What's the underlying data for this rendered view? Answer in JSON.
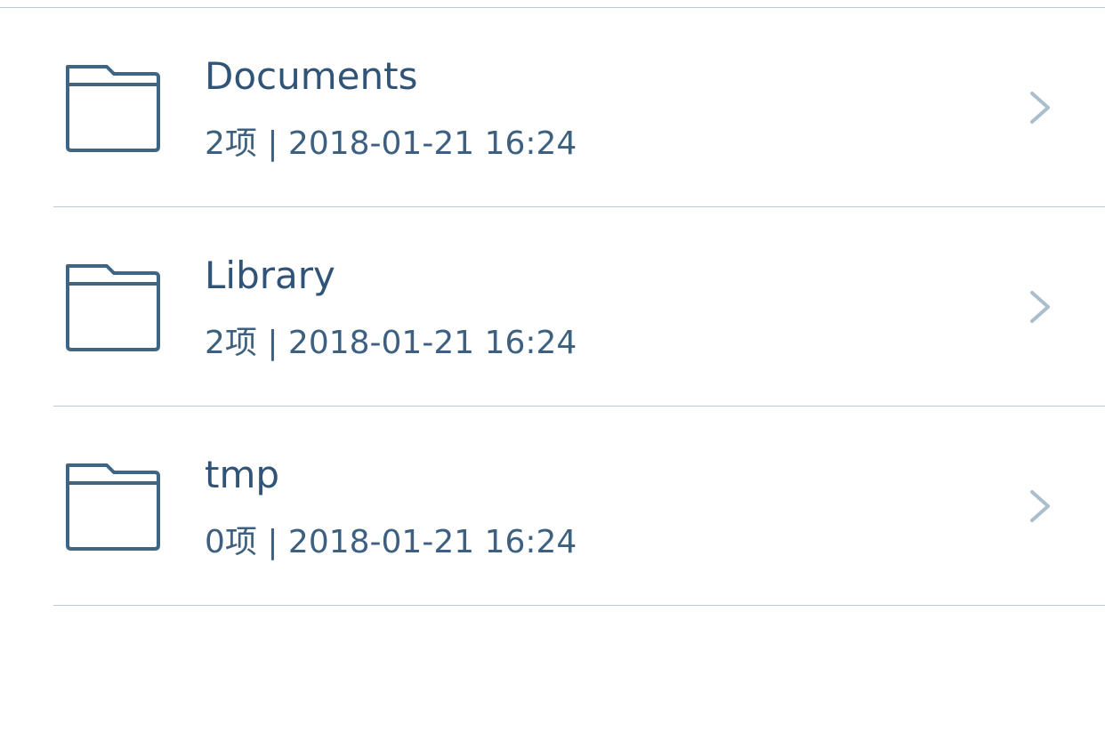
{
  "colors": {
    "text_primary": "#2f5478",
    "text_secondary": "#3d6080",
    "icon": "#3f6585",
    "chevron": "#a9bfcd",
    "separator": "#b9c8d3"
  },
  "files": [
    {
      "name": "Documents",
      "meta": "2项 | 2018-01-21 16:24",
      "icon": "folder-icon"
    },
    {
      "name": "Library",
      "meta": "2项 | 2018-01-21 16:24",
      "icon": "folder-icon"
    },
    {
      "name": "tmp",
      "meta": "0项 | 2018-01-21 16:24",
      "icon": "folder-icon"
    }
  ]
}
